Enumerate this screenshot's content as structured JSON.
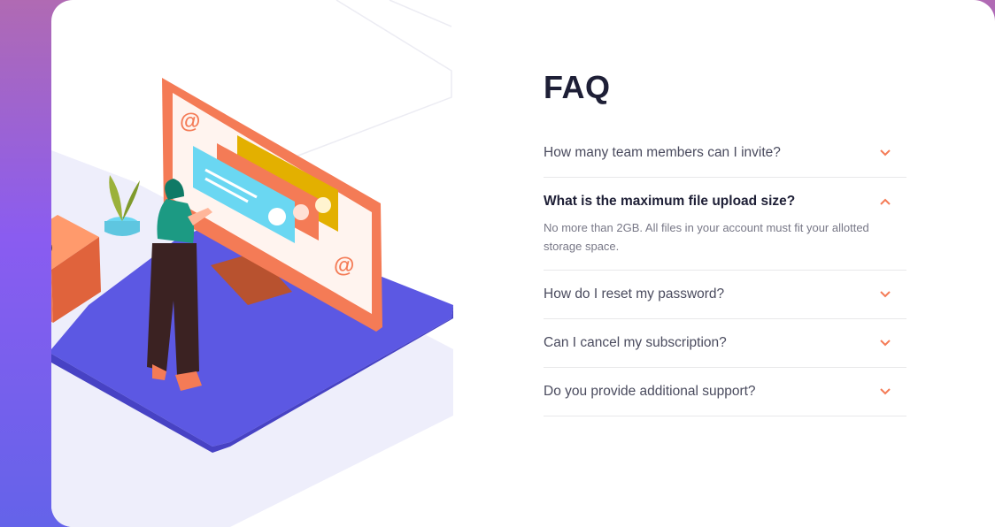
{
  "faq": {
    "title": "FAQ",
    "items": [
      {
        "question": "How many team members can I invite?",
        "open": false
      },
      {
        "question": "What is the maximum file upload size?",
        "answer": "No more than 2GB. All files in your account must fit your allotted storage space.",
        "open": true
      },
      {
        "question": "How do I reset my password?",
        "open": false
      },
      {
        "question": "Can I cancel my subscription?",
        "open": false
      },
      {
        "question": "Do you provide additional support?",
        "open": false
      }
    ]
  },
  "illustration": {
    "icons": [
      "at-sign-icon",
      "at-sign-icon",
      "at-sign-icon"
    ],
    "at_symbol": "@"
  },
  "colors": {
    "accent": "#f47b56",
    "title": "#1e1f36",
    "platform": "#5a55e0",
    "monitor": "#f47b56",
    "bg_gradient_top": "#b06ab3",
    "bg_gradient_bottom": "#6463e9"
  }
}
